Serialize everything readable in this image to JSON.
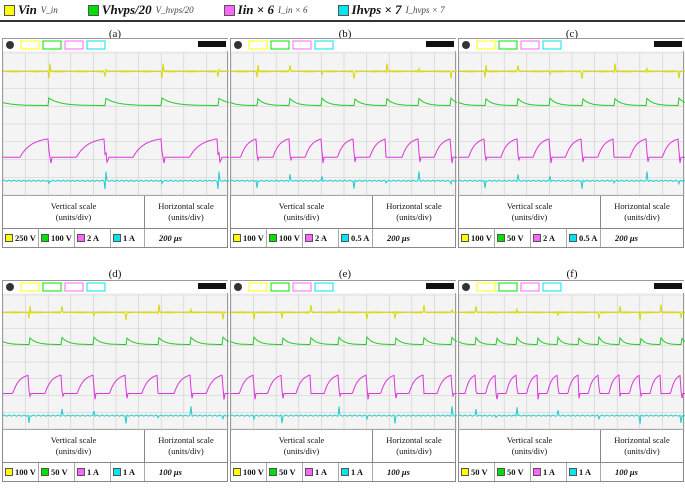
{
  "legend": [
    {
      "label": "V_in",
      "text": "Vin",
      "color": "#ffff00"
    },
    {
      "label": "V_hvps/20",
      "text": "Vhvps/20",
      "color": "#00e000"
    },
    {
      "label": "I_in × 6",
      "text": "Iin × 6",
      "color": "#ff66ff"
    },
    {
      "label": "I_hvps × 7",
      "text": "Ihvps × 7",
      "color": "#00e5ee"
    }
  ],
  "table_headers": {
    "vertical": "Vertical scale",
    "horizontal": "Horizontal scale",
    "units": "(units/div)"
  },
  "panels": [
    {
      "label": "(a)",
      "vertical": [
        "250 V",
        "100 V",
        "2 A",
        "1 A"
      ],
      "horizontal": "200 μs"
    },
    {
      "label": "(b)",
      "vertical": [
        "100 V",
        "100 V",
        "2 A",
        "0.5 A"
      ],
      "horizontal": "200 μs"
    },
    {
      "label": "(c)",
      "vertical": [
        "100 V",
        "50 V",
        "2 A",
        "0.5 A"
      ],
      "horizontal": "200 μs"
    },
    {
      "label": "(d)",
      "vertical": [
        "100 V",
        "50 V",
        "1 A",
        "1 A"
      ],
      "horizontal": "100 μs"
    },
    {
      "label": "(e)",
      "vertical": [
        "100 V",
        "50 V",
        "1 A",
        "1 A"
      ],
      "horizontal": "100 μs"
    },
    {
      "label": "(f)",
      "vertical": [
        "50 V",
        "50 V",
        "1 A",
        "1 A"
      ],
      "horizontal": "100 μs"
    }
  ],
  "colors": {
    "ch1": "#d8d800",
    "ch2": "#22cc22",
    "ch3": "#dd33dd",
    "ch4": "#22cccc"
  }
}
